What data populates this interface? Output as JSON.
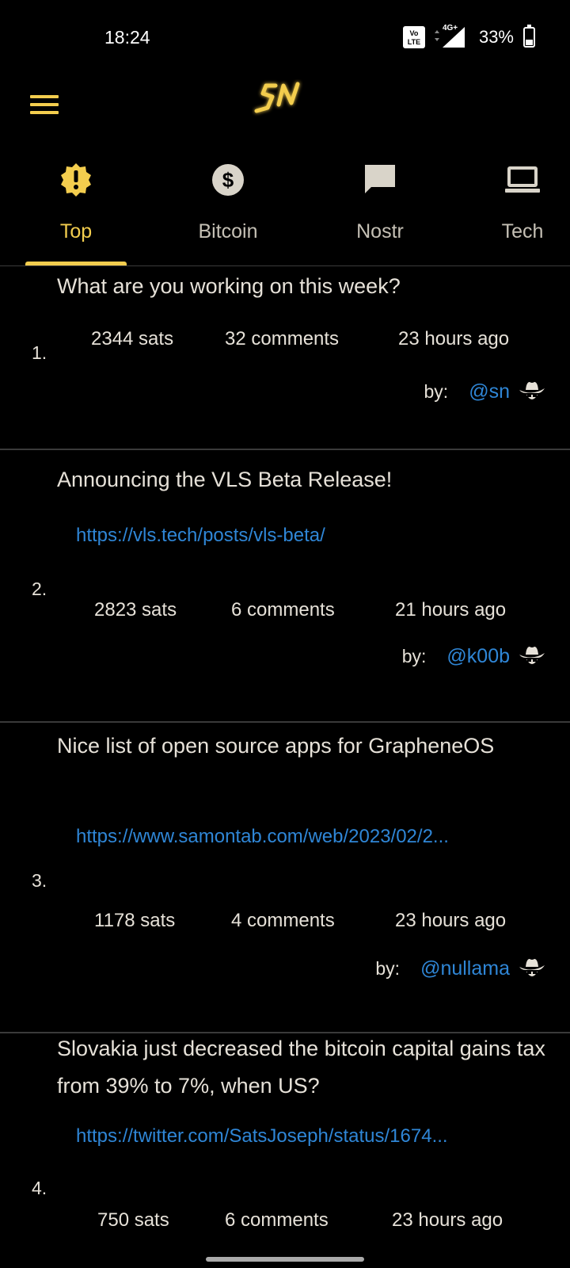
{
  "status_bar": {
    "time": "18:24",
    "volte": "Vo\nLTE",
    "network": "4G+",
    "battery_percent": "33%",
    "battery_level": 0.33
  },
  "header": {
    "menu_icon": "hamburger-menu-icon",
    "logo_text": "SN"
  },
  "tabs": [
    {
      "label": "Top",
      "icon": "alert-badge-icon",
      "active": true
    },
    {
      "label": "Bitcoin",
      "icon": "dollar-coin-icon",
      "active": false
    },
    {
      "label": "Nostr",
      "icon": "chat-bubble-icon",
      "active": false
    },
    {
      "label": "Tech",
      "icon": "laptop-icon",
      "active": false
    }
  ],
  "items": [
    {
      "rank": "1.",
      "title": "What are you working on this week?",
      "link": "",
      "sats": "2344 sats",
      "comments": "32 comments",
      "time": "23 hours ago",
      "by_label": "by:",
      "user": "@sn"
    },
    {
      "rank": "2.",
      "title": "Announcing the VLS Beta Release!",
      "link": "https://vls.tech/posts/vls-beta/",
      "sats": "2823 sats",
      "comments": "6 comments",
      "time": "21 hours ago",
      "by_label": "by:",
      "user": "@k00b"
    },
    {
      "rank": "3.",
      "title": "Nice list of open source apps for GrapheneOS",
      "link": "https://www.samontab.com/web/2023/02/2...",
      "sats": "1178 sats",
      "comments": "4 comments",
      "time": "23 hours ago",
      "by_label": "by:",
      "user": "@nullama"
    },
    {
      "rank": "4.",
      "title": "Slovakia just decreased the bitcoin capital gains tax from 39% to 7%, when US?",
      "link": "https://twitter.com/SatsJoseph/status/1674...",
      "sats": "750 sats",
      "comments": "6 comments",
      "time": "23 hours ago",
      "by_label": "",
      "user": ""
    }
  ],
  "colors": {
    "accent": "#f3cd4e",
    "link": "#2f86d6",
    "background": "#000000",
    "text": "#e6e1d8"
  }
}
